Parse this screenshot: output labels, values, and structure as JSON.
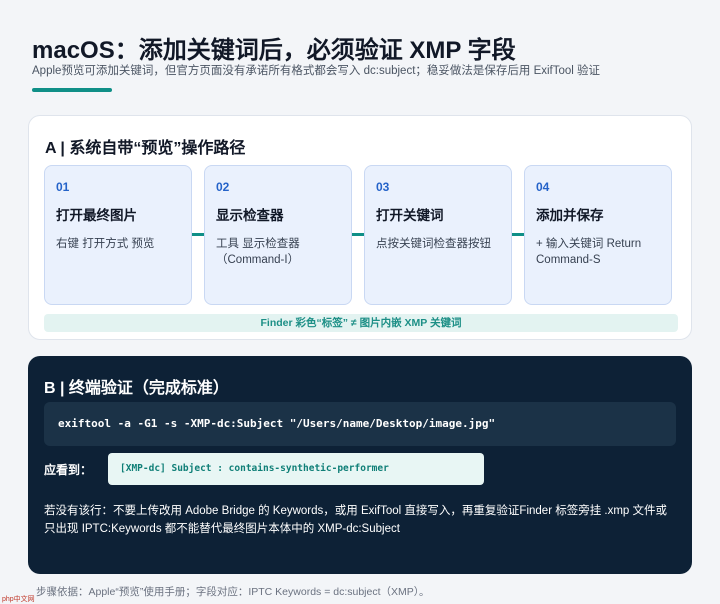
{
  "header": {
    "title": "macOS：添加关键词后，必须验证 XMP 字段",
    "subtitle": "Apple预览可添加关键词，但官方页面没有承诺所有格式都会写入 dc:subject；稳妥做法是保存后用 ExifTool 验证"
  },
  "section_a": {
    "heading": "A | 系统自带“预览”操作路径",
    "steps": [
      {
        "num": "01",
        "title": "打开最终图片",
        "desc": "右键  打开方式  预览"
      },
      {
        "num": "02",
        "title": "显示检查器",
        "desc": "工具  显示检查器（Command-I）"
      },
      {
        "num": "03",
        "title": "打开关键词",
        "desc": "点按关键词检查器按钮"
      },
      {
        "num": "04",
        "title": "添加并保存",
        "desc": "+  输入关键词  Return Command-S"
      }
    ],
    "note": "Finder 彩色“标签” ≠ 图片内嵌 XMP 关键词"
  },
  "section_b": {
    "heading": "B | 终端验证（完成标准）",
    "command": "exiftool -a -G1 -s -XMP-dc:Subject \"/Users/name/Desktop/image.jpg\"",
    "expect_label": "应看到：",
    "expect_value": "[XMP-dc] Subject : contains-synthetic-performer",
    "warning": "若没有该行：不要上传改用 Adobe Bridge 的 Keywords，或用 ExifTool 直接写入，再重复验证Finder 标签旁挂 .xmp 文件或只出现 IPTC:Keywords 都不能替代最终图片本体中的 XMP-dc:Subject"
  },
  "footer": {
    "text": "步骤依据：Apple“预览”使用手册；字段对应：IPTC Keywords = dc:subject（XMP）。"
  },
  "watermark": {
    "text": "php中文网"
  },
  "colors": {
    "accent": "#0f8f87",
    "step_bg": "#eaf1fd",
    "step_number": "#2563c9",
    "dark_panel": "#0d2136"
  }
}
